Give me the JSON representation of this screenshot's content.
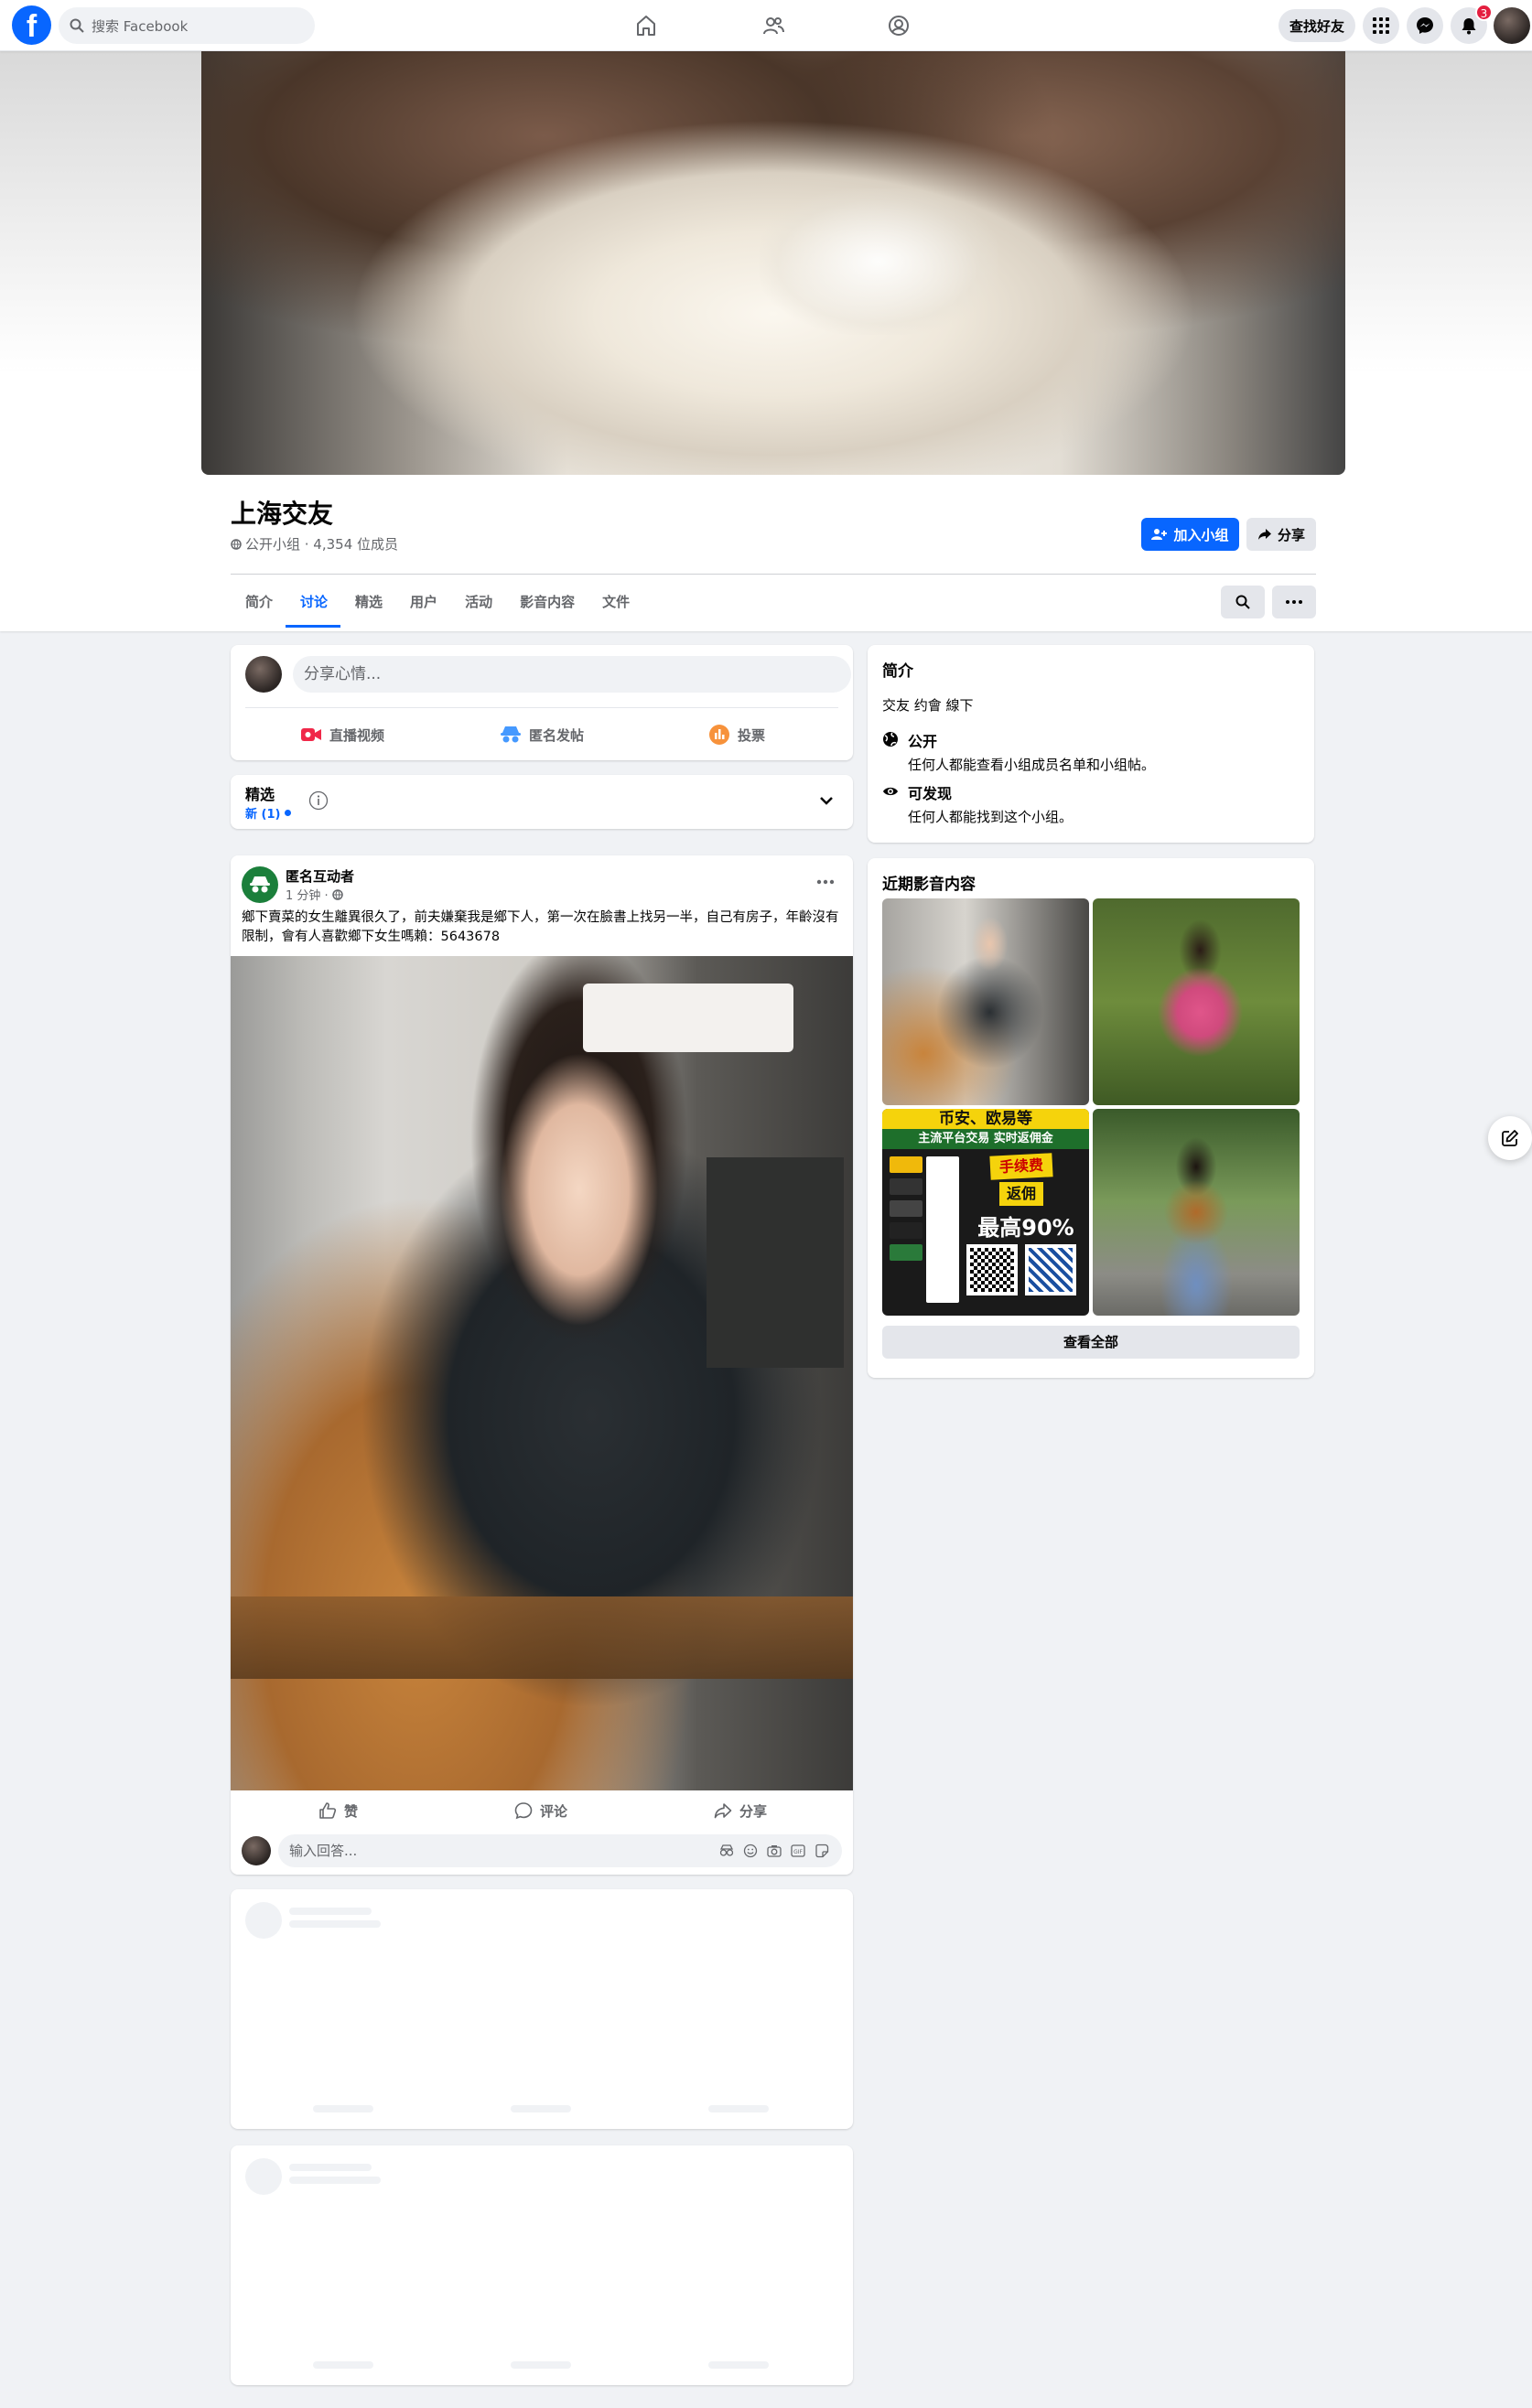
{
  "topbar": {
    "logo": "f",
    "search_placeholder": "搜索 Facebook",
    "find_friends": "查找好友",
    "notification_count": "3"
  },
  "group": {
    "name": "上海交友",
    "meta": "公开小组 · 4,354 位成员",
    "join_label": "加入小组",
    "share_label": "分享",
    "tabs": [
      "简介",
      "讨论",
      "精选",
      "用户",
      "活动",
      "影音内容",
      "文件"
    ],
    "active_tab": "讨论"
  },
  "composer": {
    "placeholder": "分享心情...",
    "actions": [
      "直播视频",
      "匿名发帖",
      "投票"
    ]
  },
  "featured": {
    "title": "精选",
    "new_label": "新 (1)"
  },
  "post": {
    "author": "匿名互动者",
    "time": "1 分钟 ·",
    "text": "鄉下賣菜的女生離異很久了，前夫嫌棄我是鄉下人，第一次在臉書上找另一半，自己有房子，年齡沒有限制，會有人喜歡鄉下女生嗎賴：5643678",
    "reactions": [
      "赞",
      "评论",
      "分享"
    ],
    "reply_placeholder": "输入回答..."
  },
  "sidebar": {
    "about_title": "简介",
    "about_desc": "交友 约會 線下",
    "items": [
      {
        "title": "公开",
        "desc": "任何人都能查看小组成员名单和小组帖。"
      },
      {
        "title": "可发现",
        "desc": "任何人都能找到这个小组。"
      }
    ],
    "media_title": "近期影音内容",
    "see_all": "查看全部",
    "ad_text": {
      "line1": "币安、欧易等",
      "line2": "主流平台交易 实时返佣金",
      "line3": "手续费",
      "line4": "返佣",
      "line5": "最高90%"
    }
  },
  "colors": {
    "brand_blue": "#0866ff",
    "badge_red": "#e41e3f",
    "bg": "#f0f2f5"
  }
}
